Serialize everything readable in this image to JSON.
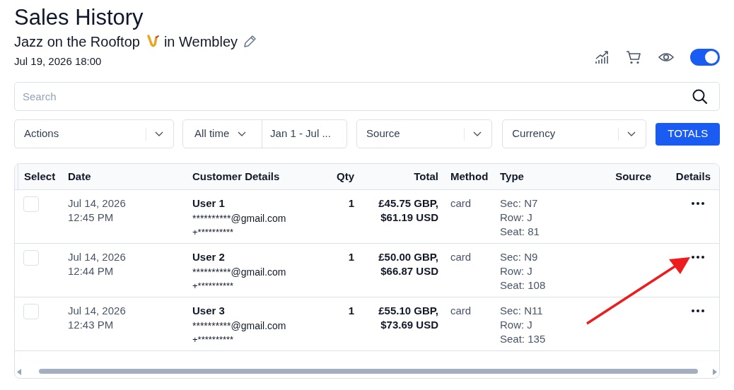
{
  "header": {
    "title": "Sales History",
    "event_name": "Jazz on the Rooftop",
    "event_venue": "in Wembley",
    "event_date": "Jul 19, 2026 18:00"
  },
  "toolbar": {
    "toggle_on": true
  },
  "search": {
    "placeholder": "Search"
  },
  "filters": {
    "actions": "Actions",
    "period": "All time",
    "date_range": "Jan 1 - Jul ...",
    "source": "Source",
    "currency": "Currency",
    "totals_button": "TOTALS"
  },
  "table": {
    "columns": [
      "Select",
      "Date",
      "Customer Details",
      "Qty",
      "Total",
      "Method",
      "Type",
      "Source",
      "Details"
    ],
    "rows": [
      {
        "checked": false,
        "date": "Jul 14, 2026",
        "time": "12:45 PM",
        "name": "User 1",
        "email": "**********@gmail.com",
        "phone": "+**********",
        "qty": "1",
        "total_gbp": "£45.75 GBP,",
        "total_usd": "$61.19 USD",
        "method": "card",
        "sec": "Sec: N7",
        "row": "Row: J",
        "seat": "Seat: 81"
      },
      {
        "checked": false,
        "date": "Jul 14, 2026",
        "time": "12:44 PM",
        "name": "User 2",
        "email": "**********@gmail.com",
        "phone": "+**********",
        "qty": "1",
        "total_gbp": "£50.00 GBP,",
        "total_usd": "$66.87 USD",
        "method": "card",
        "sec": "Sec: N9",
        "row": "Row: J",
        "seat": "Seat: 108"
      },
      {
        "checked": false,
        "date": "Jul 14, 2026",
        "time": "12:43 PM",
        "name": "User 3",
        "email": "**********@gmail.com",
        "phone": "+**********",
        "qty": "1",
        "total_gbp": "£55.10 GBP,",
        "total_usd": "$73.69 USD",
        "method": "card",
        "sec": "Sec: N11",
        "row": "Row: J",
        "seat": "Seat: 135"
      }
    ]
  }
}
